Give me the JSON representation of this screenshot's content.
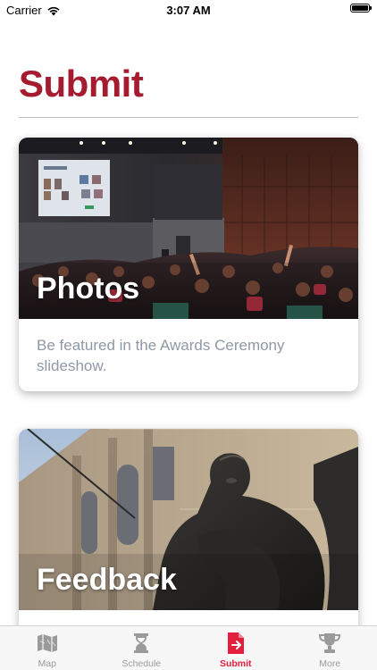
{
  "status_bar": {
    "carrier": "Carrier",
    "time": "3:07 AM"
  },
  "page": {
    "title": "Submit"
  },
  "cards": [
    {
      "heading": "Photos",
      "description": "Be featured in the Awards Ceremony slideshow."
    },
    {
      "heading": "Feedback",
      "description": ""
    }
  ],
  "tab_bar": {
    "items": [
      {
        "label": "Map",
        "icon": "map-icon",
        "active": false
      },
      {
        "label": "Schedule",
        "icon": "hourglass-icon",
        "active": false
      },
      {
        "label": "Submit",
        "icon": "submit-icon",
        "active": true
      },
      {
        "label": "More",
        "icon": "trophy-icon",
        "active": false
      }
    ]
  },
  "colors": {
    "accent": "#a51c30",
    "tab_active": "#e0203d",
    "tab_inactive": "#9a9a9a",
    "description_text": "#8e99a6"
  }
}
